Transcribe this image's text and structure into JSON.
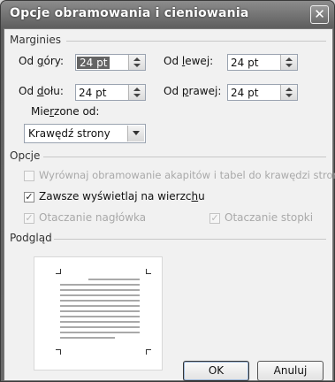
{
  "dialog": {
    "title": "Opcje obramowania i cieniowania",
    "close_glyph": "✕"
  },
  "margins": {
    "group_label": "Marginies",
    "top_label_pre": "Od ",
    "top_label_u": "g",
    "top_label_post": "óry:",
    "top_value": "24 pt",
    "left_label_pre": "Od ",
    "left_label_u": "l",
    "left_label_post": "ewej:",
    "left_value": "24 pt",
    "bottom_label_pre": "Od ",
    "bottom_label_u": "d",
    "bottom_label_post": "ołu:",
    "bottom_value": "24 pt",
    "right_label_pre": "Od ",
    "right_label_u": "p",
    "right_label_post": "rawej:",
    "right_value": "24 pt",
    "measure_label_pre": "Mie",
    "measure_label_u": "r",
    "measure_label_post": "zone od:",
    "measure_value": "Krawędź strony"
  },
  "options": {
    "group_label": "Opcje",
    "align_label": "Wyrównaj obramowanie akapitów i tabel do krawędzi strony",
    "always_front_pre": "Zawsze wyświetlaj na wierzc",
    "always_front_u": "h",
    "always_front_post": "u",
    "always_front_checked": "✓",
    "header_label": "Otaczanie nagłówka",
    "header_checked": "✓",
    "footer_label": "Otaczanie stopki",
    "footer_checked": "✓"
  },
  "preview": {
    "label": "Podgląd"
  },
  "buttons": {
    "ok": "OK",
    "cancel": "Anuluj"
  }
}
